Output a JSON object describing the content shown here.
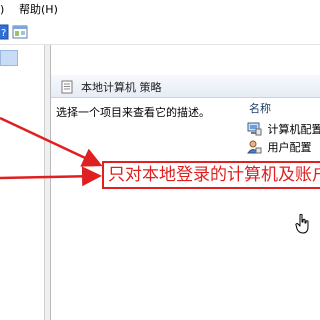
{
  "menubar": {
    "view_suffix": ")",
    "help_label": "帮助(H)"
  },
  "toolbar": {
    "buttons": [
      {
        "icon": "help-icon"
      },
      {
        "icon": "view-pane-icon"
      }
    ]
  },
  "right_pane": {
    "title": "本地计算机 策略",
    "title_icon": "document-icon",
    "description": "选择一个项目来查看它的描述。",
    "column_header": "名称",
    "items": [
      {
        "label": "计算机配置",
        "icon": "computer-config-icon"
      },
      {
        "label": "用户配置",
        "icon": "user-config-icon"
      }
    ]
  },
  "annotation": {
    "text": "只对本地登录的计算机及账户",
    "color": "#e02020"
  },
  "cursor": {
    "icon": "hand-cursor-icon"
  }
}
